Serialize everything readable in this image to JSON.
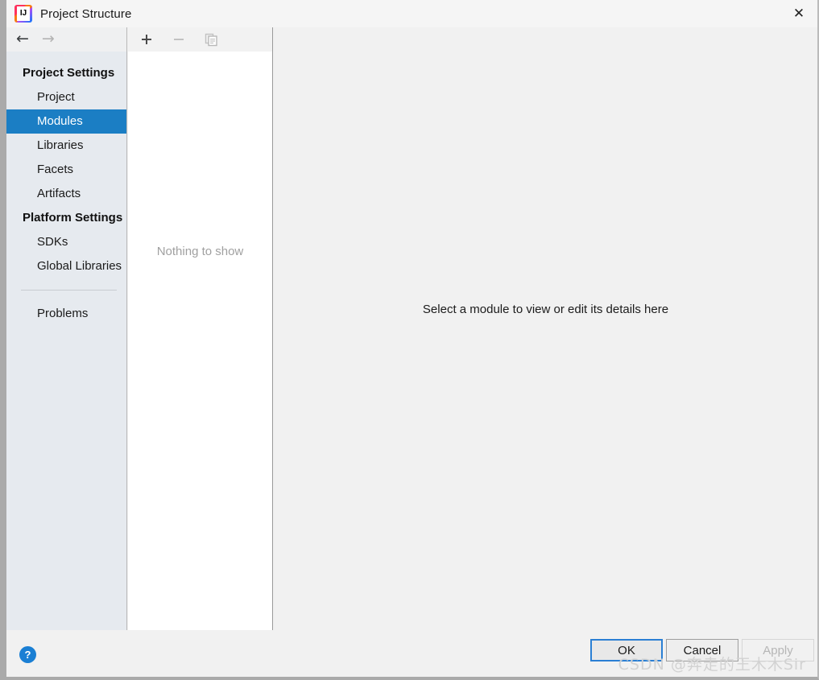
{
  "window": {
    "title": "Project Structure",
    "app_icon": "intellij-idea-icon",
    "close_label": "✕"
  },
  "navigation": {
    "back_icon": "←",
    "forward_icon": "→"
  },
  "sidebar": {
    "groups": [
      {
        "label": "Project Settings",
        "items": [
          {
            "label": "Project",
            "selected": false
          },
          {
            "label": "Modules",
            "selected": true
          },
          {
            "label": "Libraries",
            "selected": false
          },
          {
            "label": "Facets",
            "selected": false
          },
          {
            "label": "Artifacts",
            "selected": false
          }
        ]
      },
      {
        "label": "Platform Settings",
        "items": [
          {
            "label": "SDKs",
            "selected": false
          },
          {
            "label": "Global Libraries",
            "selected": false
          }
        ]
      }
    ],
    "extra_items": [
      {
        "label": "Problems",
        "selected": false
      }
    ],
    "selected_color": "#1b7ec4",
    "background_color": "#e6eaef"
  },
  "module_panel": {
    "toolbar": {
      "add_label": "+",
      "remove_label": "−",
      "copy_label": "copy-icon"
    },
    "empty_message": "Nothing to show"
  },
  "detail_panel": {
    "message": "Select a module to view or edit its details here"
  },
  "footer": {
    "help_label": "?",
    "ok_label": "OK",
    "cancel_label": "Cancel",
    "apply_label": "Apply",
    "watermark": "CSDN @奔走的王木木Sir",
    "focus_color": "#2a7fd4"
  }
}
